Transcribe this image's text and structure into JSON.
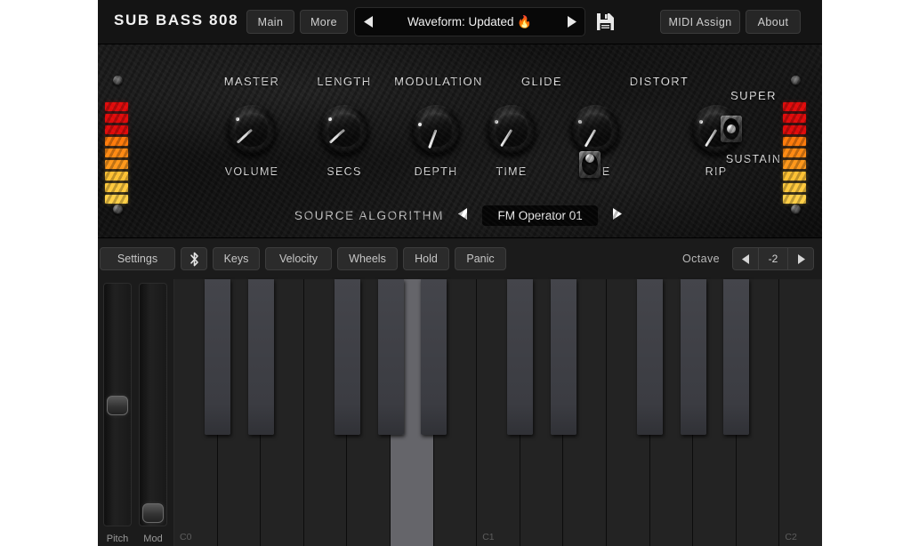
{
  "header": {
    "brand": "SUB BASS 808",
    "main_label": "Main",
    "more_label": "More",
    "midi_label": "MIDI Assign",
    "about_label": "About",
    "prev_icon": "left-triangle-icon",
    "next_icon": "right-triangle-icon",
    "save_icon": "floppy-disk-icon"
  },
  "preset": {
    "name": "Waveform: Updated 🔥"
  },
  "panel": {
    "groups": [
      {
        "title": "MASTER",
        "sub": "VOLUME"
      },
      {
        "title": "LENGTH",
        "sub": "SECS"
      },
      {
        "title": "MODULATION",
        "sub": "DEPTH"
      },
      {
        "title": "",
        "sub": "TIME"
      },
      {
        "title": "GLIDE",
        "sub": "TIME"
      },
      {
        "title": "DISTORT",
        "sub": "RIP"
      },
      {
        "title": "SUPER",
        "sub": "SUSTAIN"
      }
    ],
    "knob_values": {
      "master_volume": -132,
      "length_secs": -132,
      "modulation_depth": -160,
      "modulation_time": -148,
      "glide_time": -150,
      "distort_rip": -148
    },
    "meter": {
      "segments": 9,
      "colors": [
        "#e00a0a",
        "#e00a0a",
        "#e00a0a",
        "#ff7b0a",
        "#ff8a12",
        "#ff981a",
        "#ffc233",
        "#ffc93c",
        "#ffcf46"
      ]
    },
    "source": {
      "label": "SOURCE ALGORITHM",
      "value": "FM Operator 01",
      "prev_icon": "left-triangle-icon",
      "next_icon": "right-triangle-icon"
    }
  },
  "toolbar": {
    "settings_label": "Settings",
    "bluetooth_icon": "bluetooth-icon",
    "keys_label": "Keys",
    "velocity_label": "Velocity",
    "wheels_label": "Wheels",
    "hold_label": "Hold",
    "panic_label": "Panic",
    "octave_label": "Octave",
    "octave_value": "-2",
    "octave_prev_icon": "left-triangle-icon",
    "octave_next_icon": "right-triangle-icon"
  },
  "wheels": {
    "pitch_label": "Pitch",
    "mod_label": "Mod",
    "pitch_position": 0.5,
    "mod_position": 0.98
  },
  "keyboard": {
    "white_keys": [
      {
        "name": "C0",
        "active": false
      },
      {
        "name": "",
        "active": false
      },
      {
        "name": "",
        "active": false
      },
      {
        "name": "",
        "active": false
      },
      {
        "name": "",
        "active": false
      },
      {
        "name": "",
        "active": true
      },
      {
        "name": "",
        "active": false
      },
      {
        "name": "C1",
        "active": false
      },
      {
        "name": "",
        "active": false
      },
      {
        "name": "",
        "active": false
      },
      {
        "name": "",
        "active": false
      },
      {
        "name": "",
        "active": false
      },
      {
        "name": "",
        "active": false
      },
      {
        "name": "",
        "active": false
      },
      {
        "name": "C2",
        "active": false
      }
    ],
    "black_key_slots": [
      0,
      1,
      3,
      4,
      5,
      7,
      8,
      10,
      11,
      12
    ]
  }
}
